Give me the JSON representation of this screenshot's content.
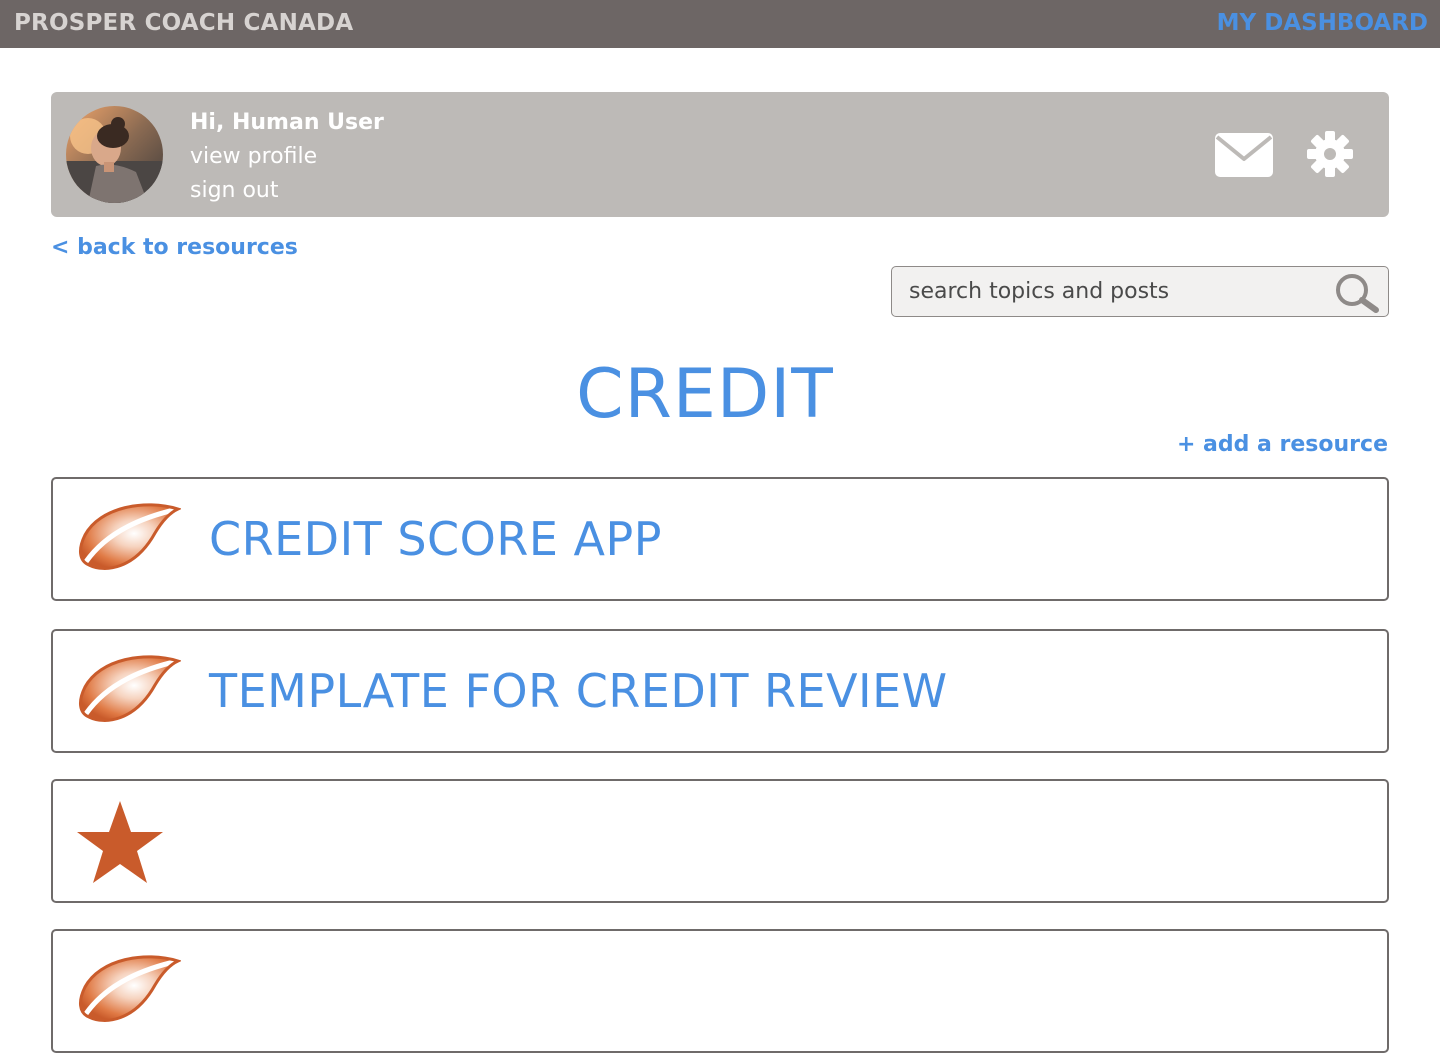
{
  "topbar": {
    "brand": "PROSPER COACH CANADA",
    "dashboard_link": "MY DASHBOARD"
  },
  "user": {
    "greeting": "Hi, Human User",
    "view_profile": "view profile",
    "sign_out": "sign out"
  },
  "nav": {
    "back_link": "< back to resources"
  },
  "search": {
    "placeholder": "search topics and posts"
  },
  "page": {
    "title": "CREDIT",
    "add_resource": "+ add a resource"
  },
  "resources": [
    {
      "title": "CREDIT SCORE APP",
      "icon": "leaf-icon"
    },
    {
      "title": "TEMPLATE FOR CREDIT REVIEW",
      "icon": "leaf-icon"
    },
    {
      "title": "",
      "icon": "star-icon"
    },
    {
      "title": "",
      "icon": "leaf-icon"
    }
  ],
  "colors": {
    "topbar": "#6d6665",
    "accent_blue": "#4a90e2",
    "panel_gray": "#bdbab7",
    "icon_orange": "#c95b2b"
  }
}
